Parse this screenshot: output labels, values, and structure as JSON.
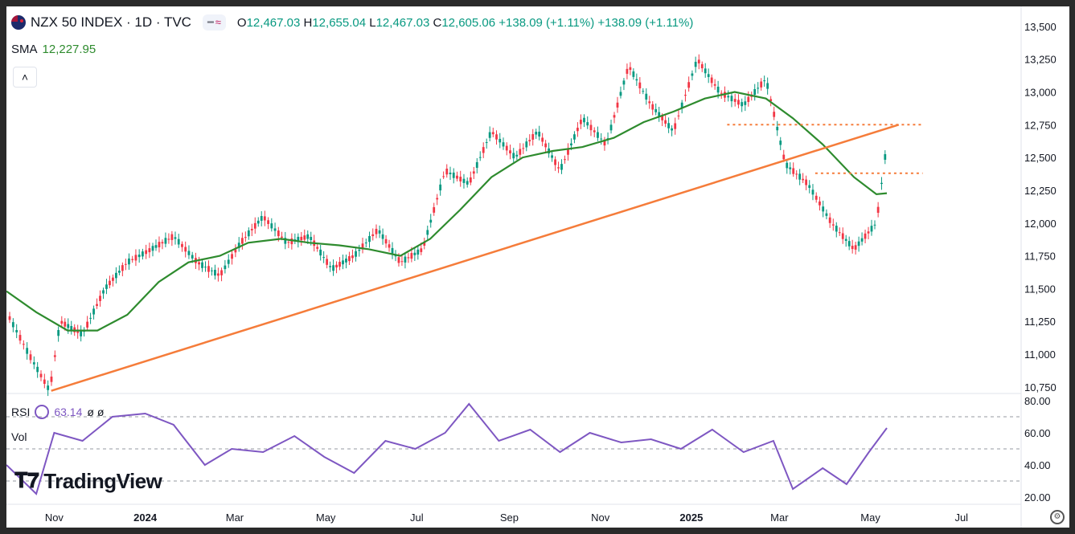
{
  "legend": {
    "symbol": "NZX 50 INDEX · 1D · TVC",
    "open_label": "O",
    "open": "12,467.03",
    "high_label": "H",
    "high": "12,655.04",
    "low_label": "L",
    "low": "12,467.03",
    "close_label": "C",
    "close": "12,605.06",
    "change": "+138.09 (+1.11%)",
    "change2": "+138.09 (+1.11%)"
  },
  "sma": {
    "label": "SMA",
    "value": "12,227.95"
  },
  "rsi": {
    "label": "RSI",
    "value": "63.14",
    "extra": "ø ø"
  },
  "vol": {
    "label": "Vol"
  },
  "brand": {
    "name": "TradingView"
  },
  "colors": {
    "up": "#089981",
    "down": "#f23645",
    "sma": "#2e8b2e",
    "trendline": "#f57c3a",
    "rsi": "#7e57c2",
    "level": "#f57c3a"
  },
  "chart_data": [
    {
      "type": "line",
      "title": "NZX 50 INDEX · 1D · TVC",
      "x_ticks": [
        "Nov",
        "2024",
        "Mar",
        "May",
        "Jul",
        "Sep",
        "Nov",
        "2025",
        "Mar",
        "May",
        "Jul"
      ],
      "y_ticks": [
        "13,500",
        "13,250",
        "13,000",
        "12,750",
        "12,500",
        "12,250",
        "12,000",
        "11,750",
        "11,500",
        "11,250",
        "11,000",
        "10,750"
      ],
      "ylim": [
        10700,
        13530
      ],
      "series": [
        {
          "name": "price",
          "x": [
            "2023-10-01",
            "2023-10-15",
            "2023-10-29",
            "2023-11-05",
            "2023-11-20",
            "2023-12-05",
            "2023-12-20",
            "2024-01-05",
            "2024-01-20",
            "2024-02-05",
            "2024-02-20",
            "2024-03-05",
            "2024-03-20",
            "2024-04-05",
            "2024-04-20",
            "2024-05-05",
            "2024-05-20",
            "2024-06-05",
            "2024-06-20",
            "2024-07-05",
            "2024-07-20",
            "2024-08-05",
            "2024-08-20",
            "2024-09-05",
            "2024-09-20",
            "2024-10-05",
            "2024-10-20",
            "2024-11-05",
            "2024-11-20",
            "2024-12-05",
            "2024-12-20",
            "2025-01-05",
            "2025-01-20",
            "2025-02-05",
            "2025-02-20",
            "2025-03-05",
            "2025-03-20",
            "2025-04-05",
            "2025-04-20",
            "2025-05-05",
            "2025-05-12"
          ],
          "values": [
            11300,
            11000,
            10720,
            11250,
            11150,
            11500,
            11700,
            11800,
            11900,
            11700,
            11600,
            11850,
            12050,
            11850,
            11900,
            11650,
            11750,
            11950,
            11700,
            11800,
            12400,
            12300,
            12700,
            12500,
            12700,
            12400,
            12800,
            12600,
            13200,
            12900,
            12700,
            13250,
            13000,
            12900,
            13100,
            12450,
            12300,
            12000,
            11800,
            12000,
            12605
          ]
        },
        {
          "name": "SMA",
          "x": [
            "2023-09-30",
            "2023-10-20",
            "2023-11-10",
            "2023-11-30",
            "2023-12-20",
            "2024-01-10",
            "2024-01-30",
            "2024-02-20",
            "2024-03-10",
            "2024-04-01",
            "2024-04-20",
            "2024-05-10",
            "2024-05-30",
            "2024-06-20",
            "2024-07-10",
            "2024-07-30",
            "2024-08-20",
            "2024-09-10",
            "2024-09-30",
            "2024-10-20",
            "2024-11-10",
            "2024-11-30",
            "2024-12-20",
            "2025-01-10",
            "2025-01-30",
            "2025-02-20",
            "2025-03-10",
            "2025-03-30",
            "2025-04-20",
            "2025-05-05",
            "2025-05-12"
          ],
          "values": [
            11480,
            11320,
            11180,
            11180,
            11300,
            11550,
            11700,
            11750,
            11850,
            11880,
            11850,
            11830,
            11800,
            11750,
            11880,
            12100,
            12350,
            12500,
            12550,
            12580,
            12650,
            12770,
            12850,
            12950,
            13000,
            12950,
            12800,
            12600,
            12350,
            12220,
            12228
          ]
        },
        {
          "name": "trendline",
          "x": [
            "2023-10-30",
            "2025-05-20"
          ],
          "values": [
            10720,
            12750
          ]
        },
        {
          "name": "resistance-upper",
          "x": [
            "2025-01-25",
            "2025-06-05"
          ],
          "values": [
            12750,
            12750
          ]
        },
        {
          "name": "resistance-lower",
          "x": [
            "2025-03-25",
            "2025-06-05"
          ],
          "values": [
            12380,
            12380
          ]
        }
      ]
    },
    {
      "type": "line",
      "title": "RSI",
      "y_ticks": [
        "80.00",
        "60.00",
        "40.00",
        "20.00"
      ],
      "ylim": [
        18,
        82
      ],
      "levels": [
        70,
        50,
        30
      ],
      "series": [
        {
          "name": "RSI",
          "x": [
            "2023-09-30",
            "2023-10-20",
            "2023-11-01",
            "2023-11-20",
            "2023-12-10",
            "2024-01-01",
            "2024-01-20",
            "2024-02-10",
            "2024-02-28",
            "2024-03-20",
            "2024-04-10",
            "2024-04-30",
            "2024-05-20",
            "2024-06-10",
            "2024-06-30",
            "2024-07-20",
            "2024-08-05",
            "2024-08-25",
            "2024-09-15",
            "2024-10-05",
            "2024-10-25",
            "2024-11-15",
            "2024-12-05",
            "2024-12-25",
            "2025-01-15",
            "2025-02-05",
            "2025-02-25",
            "2025-03-10",
            "2025-03-30",
            "2025-04-15",
            "2025-04-30",
            "2025-05-12"
          ],
          "values": [
            40,
            22,
            60,
            55,
            70,
            72,
            65,
            40,
            50,
            48,
            58,
            45,
            35,
            55,
            50,
            60,
            78,
            55,
            62,
            48,
            60,
            54,
            56,
            50,
            62,
            48,
            55,
            25,
            38,
            28,
            48,
            63
          ]
        }
      ]
    }
  ]
}
